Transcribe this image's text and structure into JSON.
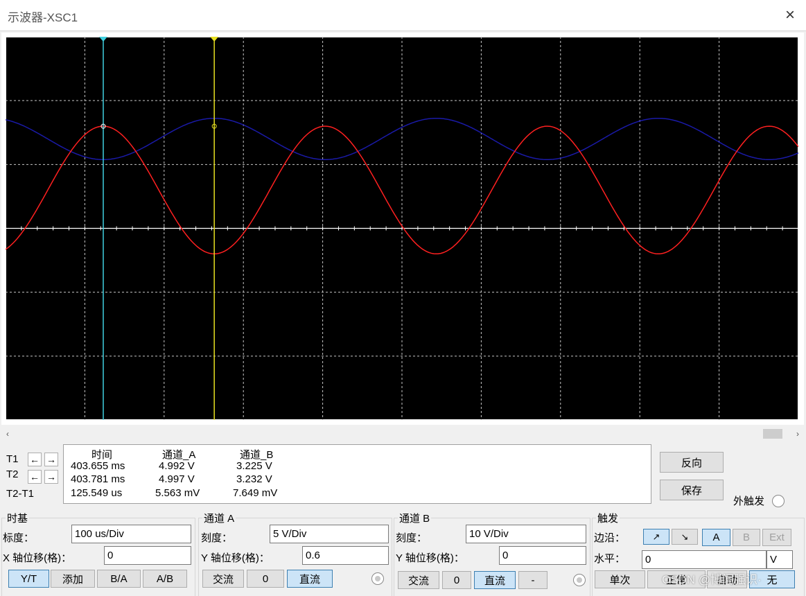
{
  "window": {
    "title": "示波器-XSC1",
    "close_icon": "×"
  },
  "scope": {
    "trace_colors": {
      "A": "#ff2020",
      "B": "#1a1aa8",
      "T1": "#40d0e0",
      "T2": "#e8e020",
      "grid": "#c8c8c8",
      "background": "#000000"
    },
    "channel_a": {
      "peak_volts": 4.997,
      "offset_divs": 0.6,
      "volts_per_div": 5
    },
    "channel_b": {
      "peak_volts": 3.232,
      "offset_divs": 0,
      "volts_per_div": 10
    },
    "cursor_markers": {
      "t1": "1",
      "t2": "2"
    }
  },
  "readout": {
    "headers": {
      "time": "时间",
      "ch_a": "通道_A",
      "ch_b": "通道_B"
    },
    "rows": [
      {
        "label": "T1",
        "time": "403.655 ms",
        "ch_a": "4.992 V",
        "ch_b": "3.225 V"
      },
      {
        "label": "T2",
        "time": "403.781 ms",
        "ch_a": "4.997 V",
        "ch_b": "3.232 V"
      },
      {
        "label": "T2-T1",
        "time": "125.549 us",
        "ch_a": "5.563 mV",
        "ch_b": "7.649 mV"
      }
    ],
    "left_icon": "←",
    "right_icon": "→"
  },
  "side_buttons": {
    "reverse": "反向",
    "save": "保存",
    "ext_trigger": "外触发"
  },
  "timebase": {
    "title": "时基",
    "scale_label": "标度：",
    "scale_value": "100 us/Div",
    "xpos_label": "X 轴位移(格)：",
    "xpos_value": "0",
    "buttons": {
      "yt": "Y/T",
      "add": "添加",
      "ba": "B/A",
      "ab": "A/B"
    }
  },
  "channel_a": {
    "title": "通道 A",
    "scale_label": "刻度：",
    "scale_value": "5  V/Div",
    "ypos_label": "Y 轴位移(格)：",
    "ypos_value": "0.6",
    "buttons": {
      "ac": "交流",
      "zero": "0",
      "dc": "直流"
    }
  },
  "channel_b": {
    "title": "通道 B",
    "scale_label": "刻度：",
    "scale_value": "10  V/Div",
    "ypos_label": "Y 轴位移(格)：",
    "ypos_value": "0",
    "buttons": {
      "ac": "交流",
      "zero": "0",
      "dc": "直流",
      "minus": "-"
    }
  },
  "trigger": {
    "title": "触发",
    "edge_label": "边沿：",
    "rising_icon": "↗",
    "falling_icon": "↘",
    "src_a": "A",
    "src_b": "B",
    "src_ext": "Ext",
    "level_label": "水平：",
    "level_value": "0",
    "level_unit": "V",
    "buttons": {
      "single": "单次",
      "normal": "正常",
      "auto": "自动",
      "none": "无"
    }
  },
  "watermark": "CSDN @博闻强识·"
}
